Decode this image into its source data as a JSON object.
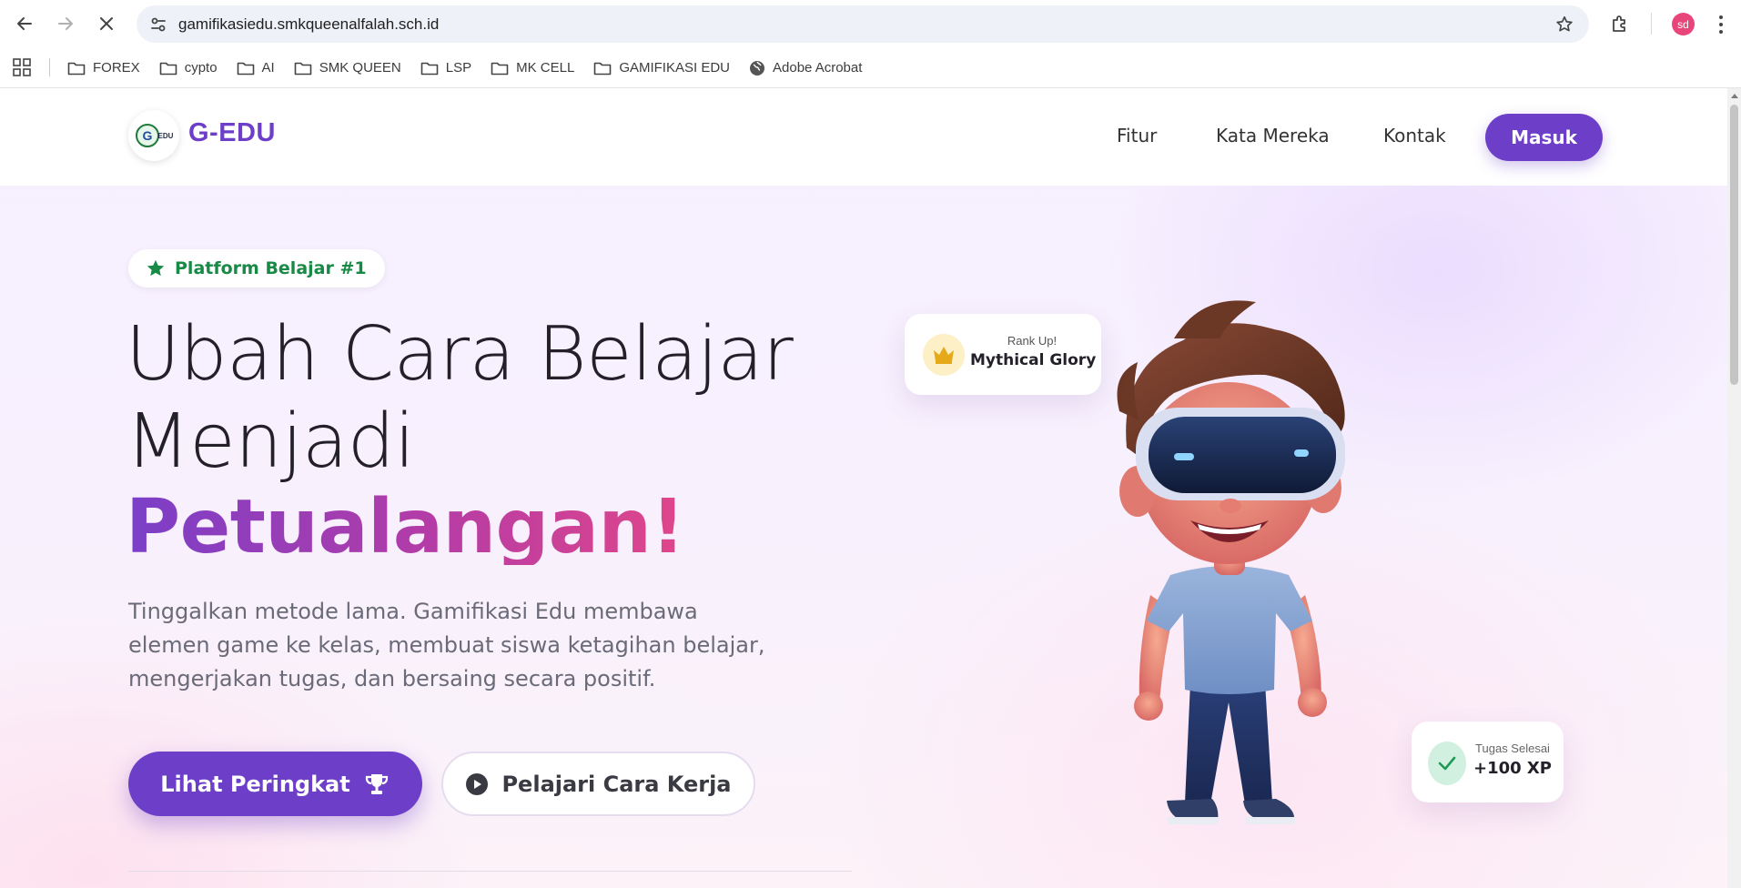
{
  "browser": {
    "url": "gamifikasiedu.smkqueenalfalah.sch.id",
    "profile_initials": "sd",
    "bookmarks": [
      {
        "label": "FOREX",
        "icon": "folder-icon"
      },
      {
        "label": "cypto",
        "icon": "folder-icon"
      },
      {
        "label": "AI",
        "icon": "folder-icon"
      },
      {
        "label": "SMK QUEEN",
        "icon": "folder-icon"
      },
      {
        "label": "LSP",
        "icon": "folder-icon"
      },
      {
        "label": "MK CELL",
        "icon": "folder-icon"
      },
      {
        "label": "GAMIFIKASI EDU",
        "icon": "folder-icon"
      },
      {
        "label": "Adobe Acrobat",
        "icon": "globe-icon"
      }
    ]
  },
  "site": {
    "logo_text": "EDU",
    "brand": "G-EDU",
    "nav": {
      "fitur": "Fitur",
      "kata_mereka": "Kata Mereka",
      "kontak": "Kontak",
      "masuk": "Masuk"
    }
  },
  "hero": {
    "badge": "Platform Belajar #1",
    "title_line1": "Ubah Cara Belajar",
    "title_line2": "Menjadi",
    "title_accent": "Petualangan!",
    "lead": "Tinggalkan metode lama. Gamifikasi Edu membawa elemen game ke kelas, membuat siswa ketagihan belajar, mengerjakan tugas, dan bersaing secara positif.",
    "cta_primary": "Lihat Peringkat",
    "cta_secondary": "Pelajari Cara Kerja",
    "card_rank": {
      "label": "Rank Up!",
      "value": "Mythical Glory"
    },
    "card_task": {
      "label": "Tugas Selesai",
      "value": "+100 XP"
    }
  },
  "colors": {
    "brand_purple": "#6d3fc8",
    "badge_green": "#178a46",
    "accent_pink": "#e0468a"
  }
}
